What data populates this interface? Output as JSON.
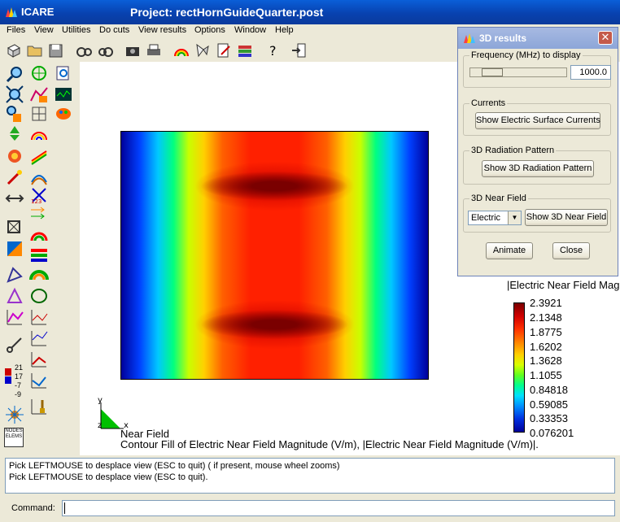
{
  "window": {
    "app_title": "ICARE",
    "project_title": "Project: rectHornGuideQuarter.post"
  },
  "menu": [
    "Files",
    "View",
    "Utilities",
    "Do cuts",
    "View results",
    "Options",
    "Window",
    "Help"
  ],
  "icons": {
    "app": "icare-logo-icon",
    "toolbar": [
      "cube-icon",
      "open-folder-icon",
      "save-disk-icon",
      "rotate-left-icon",
      "rotate-right-icon",
      "camera-icon",
      "printer-icon",
      "rainbow-icon",
      "color-scale-icon",
      "edit-doc-icon",
      "books-icon",
      "help-question-icon",
      "exit-icon"
    ]
  },
  "legend": {
    "title": "|Electric Near Field Magnitude",
    "values": [
      "2.3921",
      "2.1348",
      "1.8775",
      "1.6202",
      "1.3628",
      "1.1055",
      "0.84818",
      "0.59085",
      "0.33353",
      "0.076201"
    ],
    "colors": [
      "#7a0000",
      "#ff3000",
      "#ffd000",
      "#60ff20",
      "#00e0ff",
      "#00009a"
    ]
  },
  "plot": {
    "axis_y": "y",
    "axis_z": "z",
    "axis_x": "x",
    "caption_line1": "Near Field",
    "caption_line2": "Contour Fill of Electric Near Field Magnitude (V/m), |Electric Near Field Magnitude (V/m)|."
  },
  "leftbar_numbers": {
    "a": "21",
    "b": "17",
    "c": "-7",
    "d": "-9"
  },
  "console": {
    "line1": "Pick LEFTMOUSE to desplace view (ESC to quit) ( if present, mouse wheel zooms)",
    "line2": "Pick LEFTMOUSE to desplace view (ESC to quit)."
  },
  "command": {
    "label": "Command:",
    "value": ""
  },
  "dialog": {
    "title": "3D results",
    "close_glyph": "✕",
    "frequency_label": "Frequency (MHz) to display",
    "frequency_value": "1000.0",
    "frequency_level": 0.15,
    "currents_label": "Currents",
    "show_currents": "Show Electric Surface Currents",
    "radiation_label": "3D Radiation Pattern",
    "show_radiation": "Show 3D Radiation Pattern",
    "nearfield_label": "3D Near Field",
    "field_type": "Electric",
    "show_nearfield": "Show 3D Near Field",
    "animate": "Animate",
    "close": "Close"
  }
}
